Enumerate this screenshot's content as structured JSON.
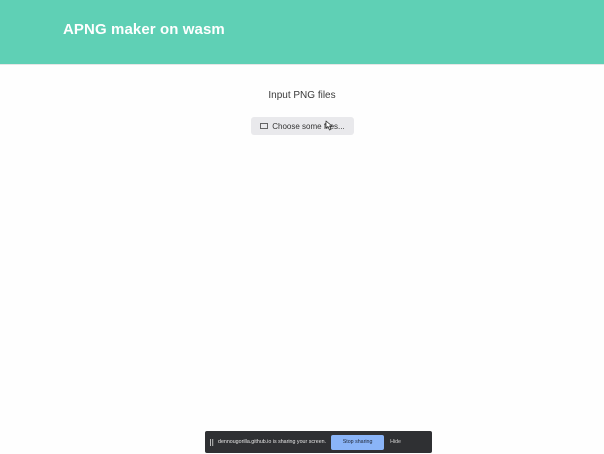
{
  "header": {
    "title": "APNG maker on wasm",
    "background": "#5fd0b5"
  },
  "main": {
    "input_label": "Input PNG files",
    "file_button_label": "Choose some files...",
    "file_button_icon": "file-icon"
  },
  "share_bar": {
    "message": "dennougorilla.github.io is sharing your screen.",
    "stop_label": "Stop sharing",
    "hide_label": "Hide",
    "stop_color": "#8ab4f8"
  }
}
